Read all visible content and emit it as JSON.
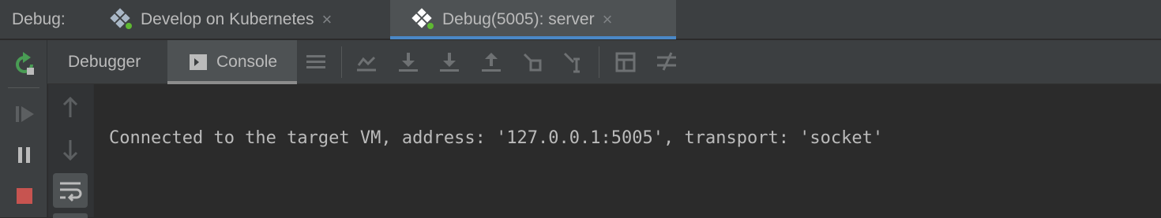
{
  "window": {
    "label": "Debug:",
    "tabs": [
      {
        "name": "Develop on Kubernetes",
        "icon": "kubernetes-icon",
        "close": "×",
        "active": false
      },
      {
        "name": "Debug(5005): server",
        "icon": "kubernetes-icon",
        "close": "×",
        "active": true
      }
    ]
  },
  "toolbar": {
    "debugger_label": "Debugger",
    "console_label": "Console"
  },
  "console": {
    "lines": [
      "Connected to the target VM, address: '127.0.0.1:5005', transport: 'socket'"
    ]
  },
  "colors": {
    "background": "#2b2b2b",
    "panel": "#3c3f41",
    "accent_blue": "#4a88c7",
    "run_green": "#499c54",
    "stop_red": "#c75450",
    "active_dot": "#5fb832"
  }
}
